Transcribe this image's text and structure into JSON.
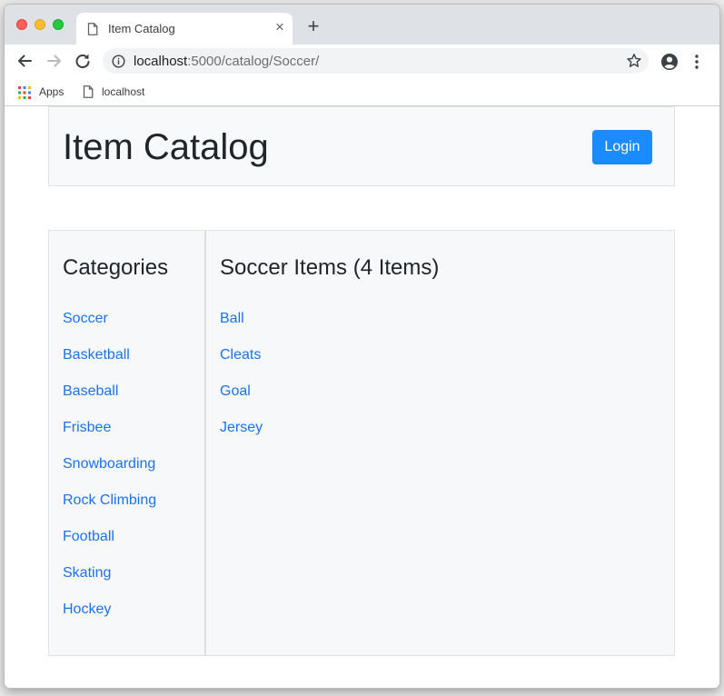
{
  "browser": {
    "tab_title": "Item Catalog",
    "tab_close": "×",
    "new_tab": "+",
    "url_host": "localhost",
    "url_rest": ":5000/catalog/Soccer/",
    "bookmarks": [
      {
        "label": "Apps",
        "icon": "apps-grid-icon"
      },
      {
        "label": "localhost",
        "icon": "page-icon"
      }
    ],
    "colors": {
      "tabstrip": "#dee1e6",
      "omnibox": "#f1f3f4"
    }
  },
  "header": {
    "title": "Item Catalog",
    "login_label": "Login"
  },
  "sidebar": {
    "heading": "Categories",
    "categories": [
      "Soccer",
      "Basketball",
      "Baseball",
      "Frisbee",
      "Snowboarding",
      "Rock Climbing",
      "Football",
      "Skating",
      "Hockey"
    ]
  },
  "items_panel": {
    "heading": "Soccer Items (4 Items)",
    "items": [
      "Ball",
      "Cleats",
      "Goal",
      "Jersey"
    ]
  },
  "colors": {
    "link": "#1a73e8",
    "button": "#1a8cff",
    "panel_bg": "#f7f8fa",
    "border": "#dee2e6"
  }
}
